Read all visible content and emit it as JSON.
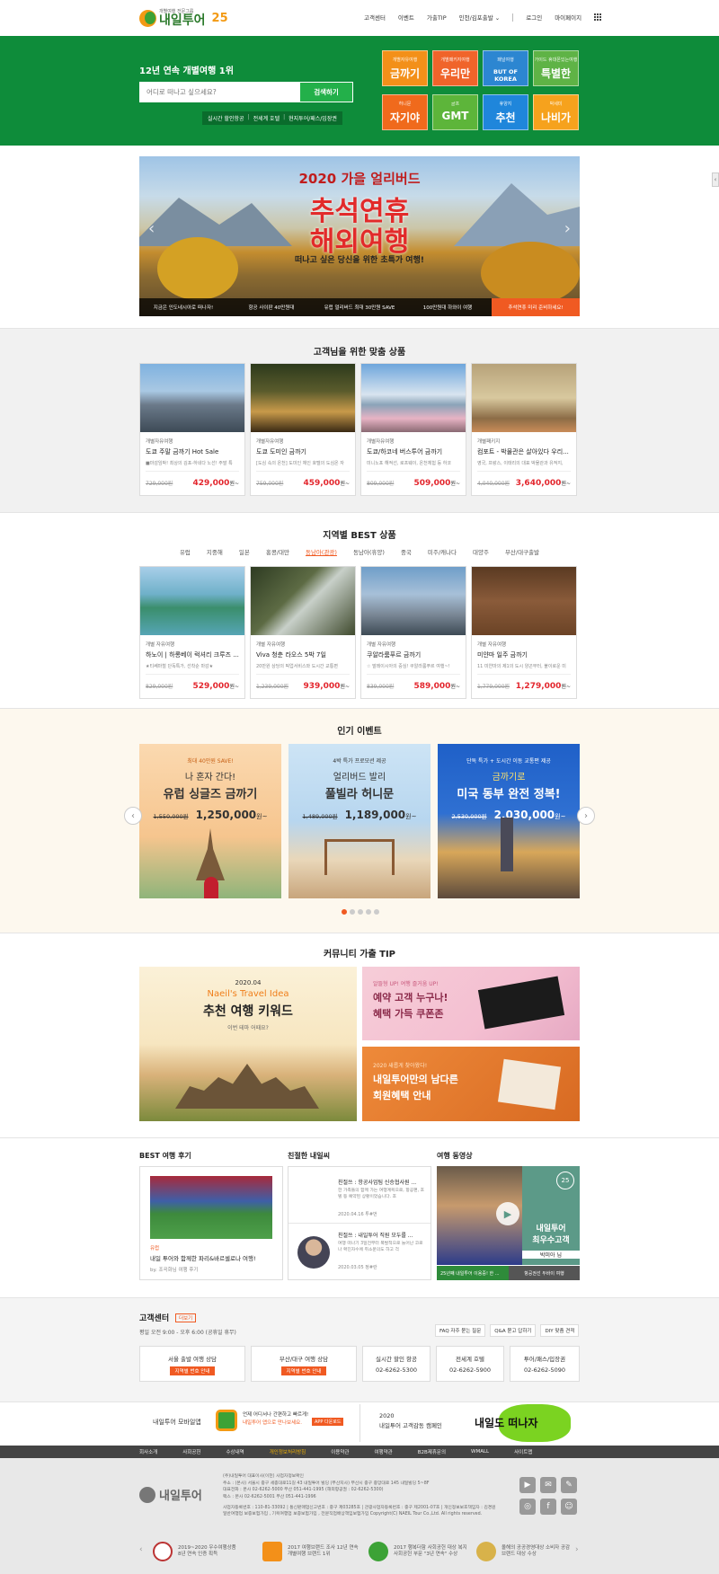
{
  "header": {
    "logo_small": "개별여행 전문그룹",
    "logo_text": "내일투어",
    "logo_25": "25",
    "nav": [
      "고객센터",
      "이벤트",
      "가출TIP",
      "인천/김포출발 ⌄",
      "로그인",
      "마이페이지"
    ]
  },
  "hero": {
    "title": "12년 연속 개별여행 1위",
    "search_placeholder": "어디로 떠나고 싶으세요?",
    "search_button": "검색하기",
    "quick_links": [
      "실시간 할인항공",
      "전세계 호텔",
      "현지투어/패스/입장권"
    ],
    "brands": [
      {
        "sub": "개별자유여행",
        "main": "금까기",
        "color": "#f39019"
      },
      {
        "sub": "개별패키지여행",
        "main": "우리만",
        "color": "#f0642a"
      },
      {
        "sub": "패널여행",
        "main": "BUT OF KOREA",
        "color": "#2c86d1"
      },
      {
        "sub": "가이드 휴대폰있는여행",
        "main": "특별한",
        "color": "#5fb346"
      },
      {
        "sub": "허니문",
        "main": "자기야",
        "color": "#f06a1c"
      },
      {
        "sub": "골프",
        "main": "GMT",
        "color": "#5db53a"
      },
      {
        "sub": "휴양지",
        "main": "추천",
        "color": "#1f86db"
      },
      {
        "sub": "박세미",
        "main": "나비가",
        "color": "#f6a21d"
      }
    ]
  },
  "banner": {
    "title": "2020 가을 얼리버드",
    "big1": "추석연휴",
    "big2": "해외여행",
    "sub": "떠나고 싶은 당신을 위한 초특가 여행!",
    "tabs": [
      "지금은 인도네시아로 떠나자!",
      "항공 사이판 40만원대",
      "유럽 얼리버드 최대 30만원 SAVE",
      "100만원대 하와이 여행",
      "추석연휴 미리 준비하세요!"
    ]
  },
  "recommend": {
    "title": "고객님을 위한 맞춤 상품",
    "cards": [
      {
        "cat": "개별자유여행",
        "title": "도쿄 주말 금까기 Hot Sale",
        "desc": "■마감임박! 최상의 김포-하네다 노선! 주말 특",
        "old": "729,000원",
        "new": "429,000",
        "won": "원~"
      },
      {
        "cat": "개별자유여행",
        "title": "도쿄 도미인 금까기",
        "desc": "[도심 속의 온천] 도미인 체인 호텔의 도심온 자",
        "old": "759,000원",
        "new": "459,000",
        "won": "원~"
      },
      {
        "cat": "개별자유여행",
        "title": "도쿄/하코네 버스투어 금까기",
        "desc": "미니노포 해적선, 로프웨이, 온천체험 등 하코",
        "old": "809,000원",
        "new": "509,000",
        "won": "원~"
      },
      {
        "cat": "개별패키지",
        "title": "컴포트 - 박물관은 살아있다 우리...",
        "desc": "영국, 프랑스, 이태리의 대표 박물관과 유적지,",
        "old": "4,040,000원",
        "new": "3,640,000",
        "won": "원~"
      }
    ]
  },
  "region": {
    "title": "지역별 BEST 상품",
    "tabs": [
      "유럽",
      "지중해",
      "일본",
      "홍콩/대만",
      "동남아(관광)",
      "동남아(휴양)",
      "중국",
      "미주/캐나다",
      "대양주",
      "부산/대구출발"
    ],
    "cards": [
      {
        "cat": "개별 자유여행",
        "title": "하노이 | 하롱베이 럭셔리 크루즈 ...",
        "desc": "★티쎄마철 단독특가, 선착순 마감★",
        "old": "829,000원",
        "new": "529,000",
        "won": "원~"
      },
      {
        "cat": "개별 자유여행",
        "title": "Viva 청춘 라오스 5박 7일",
        "desc": "20만원 상당의 픽업서비스와 도시간 교통편",
        "old": "1,239,000원",
        "new": "939,000",
        "won": "원~"
      },
      {
        "cat": "개별 자유여행",
        "title": "쿠알라룸푸르 금까기",
        "desc": "☆ 말레이시아의 중심! 쿠알라룸푸르 여행~!",
        "old": "839,000원",
        "new": "589,000",
        "won": "원~"
      },
      {
        "cat": "개별 자유여행",
        "title": "미얀마 일주 금까기",
        "desc": "11 미얀마의 제1의 도시 양곤부터, 불이로운 미",
        "old": "1,779,000원",
        "new": "1,279,000",
        "won": "원~"
      }
    ]
  },
  "events": {
    "title": "인기 이벤트",
    "items": [
      {
        "sub": "최대 40만원 SAVE!",
        "t1": "나 혼자 간다!",
        "t2": "유럽 싱글즈 금까기",
        "old": "1,550,000원",
        "new": "1,250,000",
        "won": "원~"
      },
      {
        "sub": "4박 특가 프로모션 제공",
        "t1": "얼리버드 발리",
        "t2": "풀빌라 허니문",
        "old": "1,489,000원",
        "new": "1,189,000",
        "won": "원~"
      },
      {
        "sub": "단독 특가 + 도시간 이동 교통편 제공",
        "t1": "금까기로",
        "t2": "미국 동부 완전 정복!",
        "old": "2,530,000원",
        "new": "2,030,000",
        "won": "원~"
      }
    ]
  },
  "community": {
    "title": "커뮤니티 가출 TIP",
    "keyword": {
      "date": "2020.04",
      "brand": "Naeil's Travel Idea",
      "title": "추천 여행 키워드",
      "sub": "이번 테마 어때요?"
    },
    "coupon": {
      "sub": "알뜰형 UP! 여행 즐거움 UP!",
      "l1": "예약 고객 누구나!",
      "l2": "혜택 가득 쿠폰존"
    },
    "member": {
      "sub": "2020 새롭게 찾아왔다!",
      "l1": "내일투어만의 남다른",
      "l2": "회원혜택 안내"
    }
  },
  "review": {
    "title": "BEST 여행 후기",
    "tag": "유럽",
    "ttl": "내일 투어와 함께한 파리&바르셀로나 여행!",
    "by": "by. 조곡화님 여행 후기"
  },
  "kind": {
    "title": "친절한 내일씨",
    "items": [
      {
        "title": "친절쓰 : 항공사업팀 신승협사원 ...",
        "desc": "한 가족들의 함께 가는 여행계획으로, 항공편, 호텔 등 예약된 상황이었습니다. 호",
        "date": "2020.04.16 투#번"
      },
      {
        "title": "친절쓰 : 내일투어 직원 모두를 ...",
        "desc": "여행 떠나기 3일전부터 폭발적으로 늘어난 코로나 확진자수에 취소문의도 하고 걱",
        "date": "2020.03.05 정#란"
      }
    ]
  },
  "video": {
    "title": "여행 동영상",
    "side1": "내일투어",
    "side2": "최우수고객",
    "name": "박미아 님",
    "btn1": "25년째 내일투어 이용중! 한 ...",
    "btn2": "항공권선 두바이 여행"
  },
  "service": {
    "title": "고객센터",
    "more": "더보기",
    "hours": "평일 오전 9:00 - 오후 6:00 (공휴일 휴무)",
    "faq": [
      "FAQ 자주 묻는 질문",
      "Q&A 묻고 답하기",
      "DIY 맞춤 견적"
    ],
    "boxes": [
      {
        "l1": "서울 출발 여행 상담",
        "badge": "지역별 번호 안내"
      },
      {
        "l1": "부산/대구 여행 상담",
        "badge": "지역별 번호 안내"
      },
      {
        "l1": "실시간 할인 항공",
        "l2": "02-6262-5300"
      },
      {
        "l1": "전세계 호텔",
        "l2": "02-6262-5900"
      },
      {
        "l1": "투어/패스/입장권",
        "l2": "02-6262-5090"
      }
    ]
  },
  "mobile": {
    "label": "내일투어 모바일앱",
    "l1": "언제 어디서나 간편하고 빠르게!",
    "l2": "내일투어 앱으로 만나보세요.",
    "badge": "APP 다운로드",
    "year": "2020",
    "camp": "내일투어 고객감동 캠페인",
    "camp_big": "내일도 떠나자"
  },
  "footer_nav": [
    "회사소개",
    "사회공헌",
    "수상내역",
    "개인정보처리방침",
    "이용약관",
    "여행약관",
    "B2B제휴문의",
    "WMALL",
    "사이트맵"
  ],
  "footer": {
    "logo": "내일투어",
    "lines": [
      "(주)내일투어 대표이사(이천)     사업자정보확인",
      "주소 : (본사) 서울시 중구 세종대로11길 43 내일투어 빌딩 (부산지사) 부산시 중구 중앙대로 145 내일빌딩 5~8F",
      "대표전화 : 본사 02-6262-5000 부산 051-441-1995 (해외항공권 : 02-6262-5300)",
      "팩스 : 본사 02-6262-5001 부산 051-441-1996",
      "사업자등록번호 : 110-81-33092 | 통신판매업신고번호 : 중구 제03285호 | 관광사업자등록번호 : 중구 제2001-07호 | 개인정보보호책임자 : 김경원",
      "일반여행업 보증보험가입 , 기획여행업 보증보험가입 , 전문직업배상책임보험가입 Copyright(C) NAEIL Tour Co.,Ltd. All rights reserved."
    ],
    "awards": [
      "2019~2020 우수여행상품 8년 연속 인증 획득",
      "2017 여행브랜드 조사 12년 연속 개별여행 브랜드 1위",
      "2017 행복더함 사회공헌 대상 복지사회공헌 부문 \"3년 연속\" 수상",
      "올해의 공공경영대상 소비자 공감 브랜드 대상 수상"
    ]
  }
}
